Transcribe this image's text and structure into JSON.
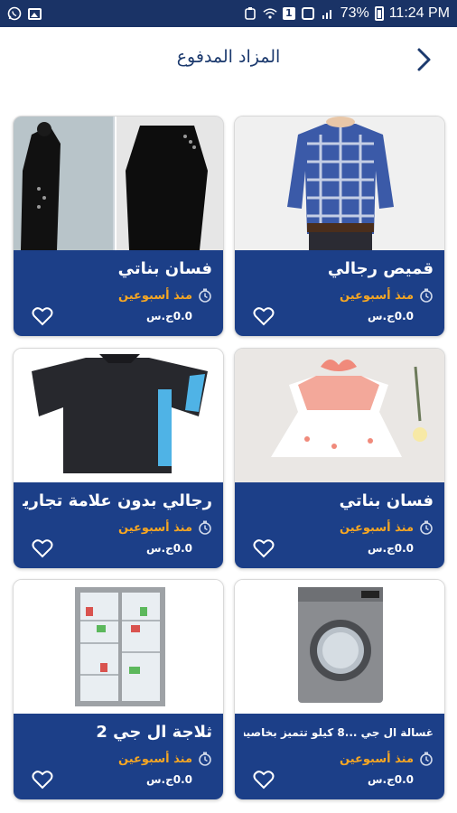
{
  "status_bar": {
    "battery": "73%",
    "time": "11:24 PM",
    "sim_label": "1"
  },
  "header": {
    "title": "المزاد المدفوع"
  },
  "products": [
    {
      "title": "قميص رجالي",
      "time": "منذ أسبوعين",
      "price": "0.0ج.س"
    },
    {
      "title": "فسان بناتي",
      "time": "منذ أسبوعين",
      "price": "0.0ج.س"
    },
    {
      "title": "فسان بناتي",
      "time": "منذ أسبوعين",
      "price": "0.0ج.س"
    },
    {
      "title": "رجالي بدون علامة تجارية",
      "time": "منذ أسبوعين",
      "price": "0.0ج.س"
    },
    {
      "title": "غسالة ال جي ...8 كيلو تتميز بخاصية",
      "time": "منذ أسبوعين",
      "price": "0.0ج.س"
    },
    {
      "title": "ثلاجة ال جي 2",
      "time": "منذ أسبوعين",
      "price": "0.0ج.س"
    }
  ],
  "colors": {
    "status_bar": "#1a3366",
    "card_info_bg": "#1c3f88",
    "time_accent": "#f5a623",
    "title_color": "#1c3a6e"
  },
  "icons": {
    "back": "chevron-right-icon",
    "clock": "clock-icon",
    "favorite": "heart-outline-icon"
  }
}
